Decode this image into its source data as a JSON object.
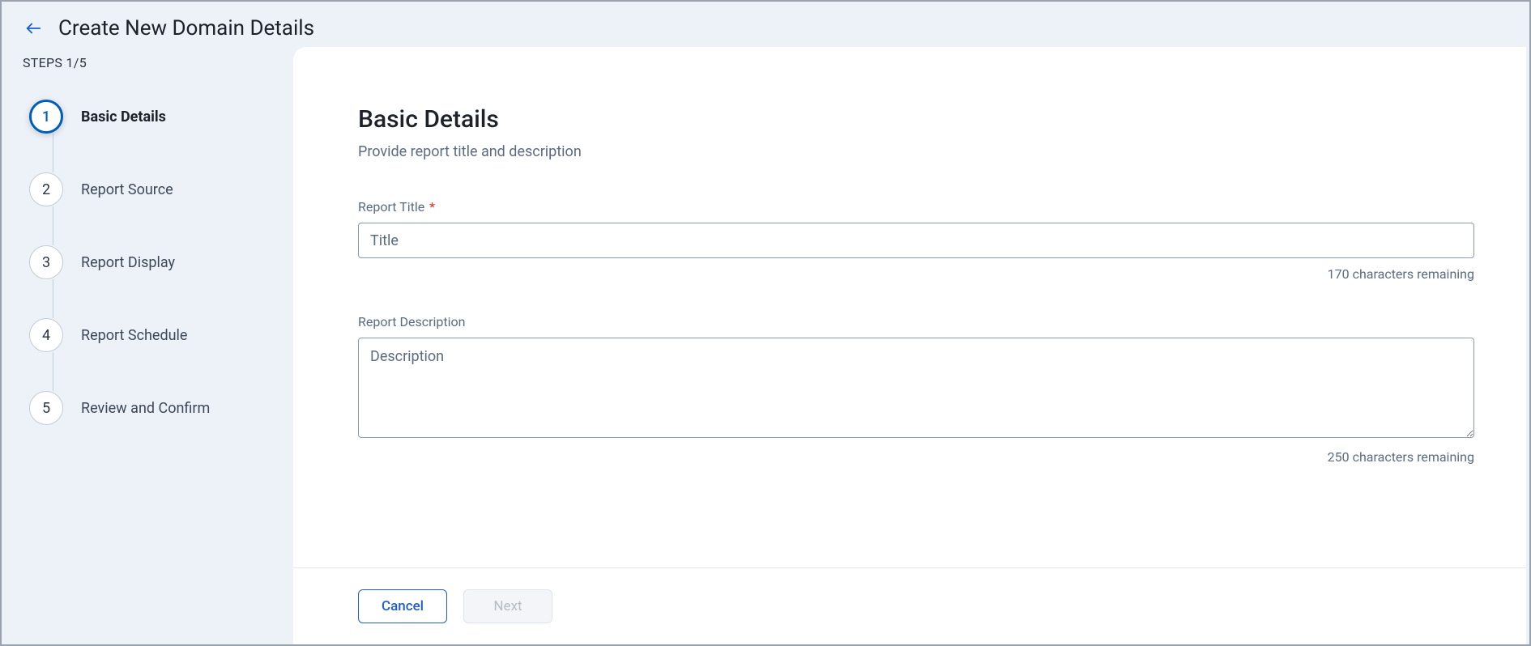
{
  "header": {
    "title": "Create New Domain Details"
  },
  "sidebar": {
    "counter": "STEPS 1/5",
    "steps": [
      {
        "num": "1",
        "label": "Basic Details",
        "active": true
      },
      {
        "num": "2",
        "label": "Report Source",
        "active": false
      },
      {
        "num": "3",
        "label": "Report Display",
        "active": false
      },
      {
        "num": "4",
        "label": "Report Schedule",
        "active": false
      },
      {
        "num": "5",
        "label": "Review and Confirm",
        "active": false
      }
    ]
  },
  "main": {
    "section_title": "Basic Details",
    "section_subtitle": "Provide report title and description",
    "title_field": {
      "label": "Report Title",
      "required_mark": "*",
      "placeholder": "Title",
      "value": "",
      "counter": "170 characters remaining"
    },
    "desc_field": {
      "label": "Report Description",
      "placeholder": "Description",
      "value": "",
      "counter": "250 characters remaining"
    }
  },
  "footer": {
    "cancel": "Cancel",
    "next": "Next"
  }
}
